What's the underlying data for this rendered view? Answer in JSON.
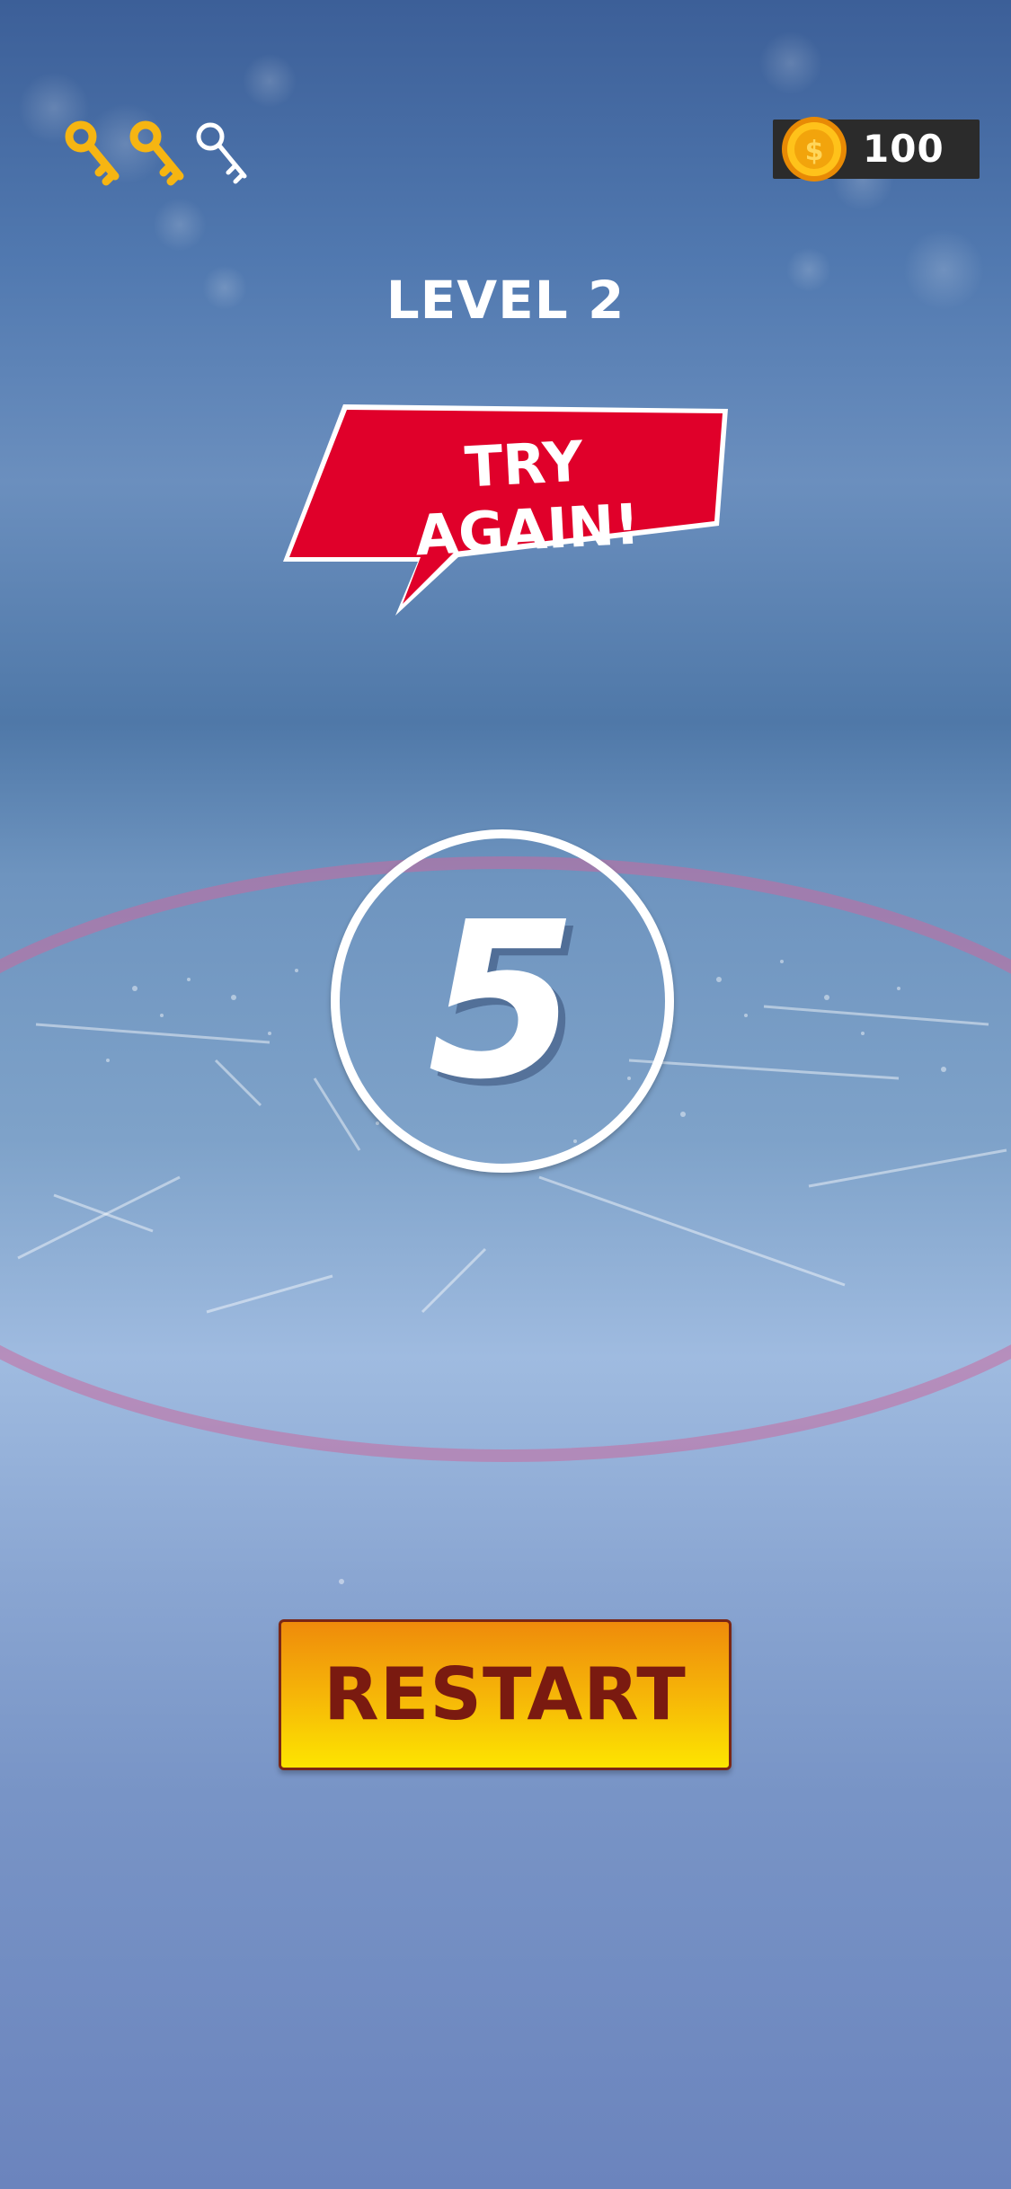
{
  "hud": {
    "keys": [
      {
        "icon": "key-icon",
        "state": "collected",
        "color": "#f6b512"
      },
      {
        "icon": "key-icon",
        "state": "collected",
        "color": "#f6b512"
      },
      {
        "icon": "key-icon",
        "state": "empty",
        "color": "#ffffff"
      }
    ],
    "coins": {
      "icon": "coin-icon",
      "value": "100"
    }
  },
  "level": {
    "title": "LEVEL 2"
  },
  "result": {
    "message": "TRY AGAIN!",
    "accent": "#e0002a"
  },
  "counter": {
    "value": "5"
  },
  "actions": {
    "restart_label": "RESTART"
  }
}
